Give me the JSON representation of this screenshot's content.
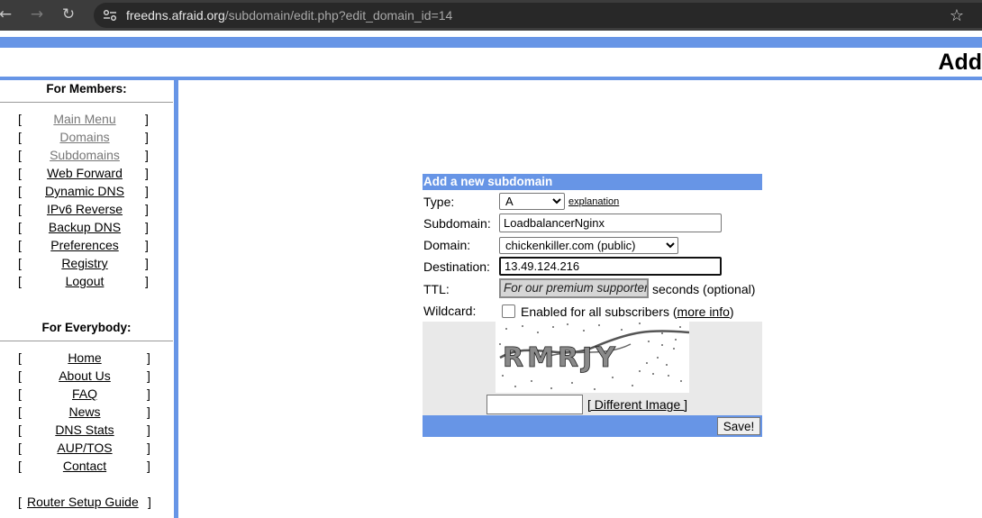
{
  "browser": {
    "host": "freedns.afraid.org",
    "path": "/subdomain/edit.php?edit_domain_id=14"
  },
  "page": {
    "title": "Add"
  },
  "sidebar": {
    "members_heading": "For Members:",
    "members_items": [
      {
        "label": "Main Menu"
      },
      {
        "label": "Domains"
      },
      {
        "label": "Subdomains"
      },
      {
        "label": "Web Forward"
      },
      {
        "label": "Dynamic DNS"
      },
      {
        "label": "IPv6 Reverse"
      },
      {
        "label": "Backup DNS"
      },
      {
        "label": "Preferences"
      },
      {
        "label": "Registry"
      },
      {
        "label": "Logout"
      }
    ],
    "everybody_heading": "For Everybody:",
    "everybody_items": [
      {
        "label": "Home"
      },
      {
        "label": "About Us"
      },
      {
        "label": "FAQ"
      },
      {
        "label": "News"
      },
      {
        "label": "DNS Stats"
      },
      {
        "label": "AUP/TOS"
      },
      {
        "label": "Contact"
      }
    ],
    "router_guide": "Router Setup Guide",
    "bracket_open": "[",
    "bracket_close": "]"
  },
  "form": {
    "header": "Add a new subdomain",
    "type_label": "Type:",
    "type_value": "A",
    "explanation_link": "explanation",
    "subdomain_label": "Subdomain:",
    "subdomain_value": "LoadbalancerNginx",
    "domain_label": "Domain:",
    "domain_value": "chickenkiller.com (public)",
    "destination_label": "Destination:",
    "destination_value": "13.49.124.216",
    "ttl_label": "TTL:",
    "ttl_value": "For our premium supporters",
    "ttl_suffix": "seconds (optional)",
    "wildcard_label": "Wildcard:",
    "wildcard_text": "Enabled for all subscribers (",
    "wildcard_link": "more info",
    "wildcard_close": ")",
    "wildcard_checked": false,
    "captcha_text": "RMRJY",
    "different_image": "[ Different Image ]",
    "save_button": "Save!"
  }
}
